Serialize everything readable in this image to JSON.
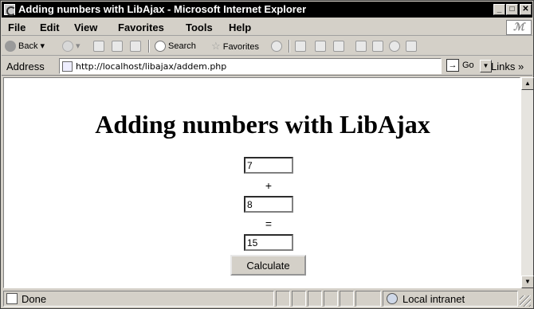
{
  "window": {
    "title": "Adding numbers with LibAjax - Microsoft Internet Explorer"
  },
  "menu": [
    "File",
    "Edit",
    "View",
    "Favorites",
    "Tools",
    "Help"
  ],
  "toolbar": {
    "back": "Back",
    "search": "Search",
    "favorites": "Favorites"
  },
  "address": {
    "label": "Address",
    "url": "http://localhost/libajax/addem.php",
    "go": "Go",
    "links": "Links"
  },
  "page": {
    "heading": "Adding numbers with LibAjax",
    "first_value": "7",
    "plus": "+",
    "second_value": "8",
    "equals": "=",
    "result_value": "15",
    "calculate": "Calculate"
  },
  "status": {
    "text": "Done",
    "zone": "Local intranet"
  }
}
